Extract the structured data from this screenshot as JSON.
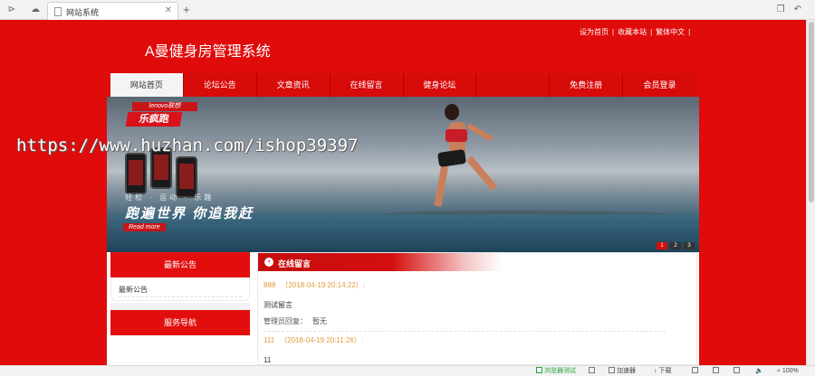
{
  "browser": {
    "tab_title": "网站系统",
    "zoom": "100%",
    "status": {
      "green_label": "浏览器测试",
      "accelerate": "加速器",
      "download": "下载"
    }
  },
  "site": {
    "title": "A曼健身房管理系统",
    "toplinks": [
      "设为首页",
      "收藏本站",
      "繁体中文"
    ],
    "nav": [
      "网站首页",
      "论坛公告",
      "文章资讯",
      "在线留言",
      "健身论坛",
      "",
      "免费注册",
      "会员登录"
    ]
  },
  "banner": {
    "logo": "lenovo联想",
    "brand": "乐疯跑",
    "slogan": "跑遍世界 你追我赶",
    "sub": "轻松 · 运动 · 乐趣",
    "more": "Read more",
    "dots": [
      "1",
      "2",
      "3"
    ]
  },
  "watermark": "https://www.huzhan.com/ishop39397",
  "sidebar": {
    "notice_title": "最新公告",
    "notice_item": "最新公告",
    "service_title": "服务导航"
  },
  "messages": {
    "title": "在线留言",
    "reply_label": "管理员回复：",
    "items": [
      {
        "name": "888",
        "time": "（2018-04-19 20:14:22）:",
        "text": "测试留言",
        "reply": "暂无"
      },
      {
        "name": "111",
        "time": "（2018-04-19 20:11:26）:",
        "text": "11",
        "reply": ""
      }
    ]
  },
  "colors": {
    "brand_red": "#e00b0b",
    "nav_active_bg": "#f4f4f4",
    "meta_orange": "#e39a3f"
  }
}
